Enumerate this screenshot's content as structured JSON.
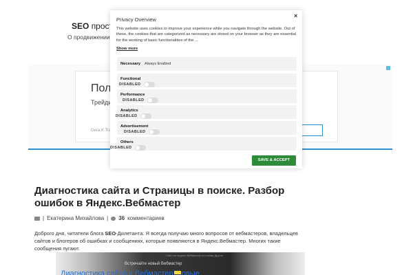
{
  "header": {
    "title_bold": "SEO",
    "title_rest": "прост",
    "tagline": "О продвижении б"
  },
  "ad": {
    "title": "Полу",
    "subtitle": "Трейди",
    "source": "Gera.K Trading"
  },
  "article": {
    "title": "Диагностика сайта и Страницы в поиске. Разбор ошибок в Яндекс.Вебмастер",
    "author": "Екатерина Михайлова",
    "comments_count": "36",
    "comments_label": "комментариев",
    "body_part1": "Доброго дня, читатели блога ",
    "body_bold": "SEO",
    "body_part2": "-Дилетанта. Я всегда получаю много вопросов от вебмастеров, владельцев сайтов и блогеров об ошибках и сообщениях, которые появляются в Яндекс.Вебмастер. Многих такие сообщения пугают."
  },
  "video": {
    "nav": "Сайт на ладони   Вебмастер по шагам   Другое",
    "caption": "Встречайте новый Вебмастер",
    "link": "Диагностика сайта и Вебмастер: новые"
  },
  "privacy": {
    "title": "Privacy Overview",
    "close": "×",
    "description": "This website uses cookies to improve your experience while you navigate through the website. Out of these, the cookies that are categorized as necessary are stored on your browser as they are essential for the working of basic functionalities of the ...",
    "show_more": "Show more",
    "categories": [
      {
        "name": "Necessary",
        "status": "Always Enabled"
      },
      {
        "name": "Functional",
        "status": "DISABLED"
      },
      {
        "name": "Performance",
        "status": "DISABLED"
      },
      {
        "name": "Analytics",
        "status": "DISABLED"
      },
      {
        "name": "Advertisement",
        "status": "DISABLED"
      },
      {
        "name": "Others",
        "status": "DISABLED"
      }
    ],
    "accept_label": "SAVE & ACCEPT"
  },
  "colors": {
    "accept": "#2e8b3a",
    "accent_blue": "#2a8fd0",
    "category_bg": "#f2f2f2"
  }
}
